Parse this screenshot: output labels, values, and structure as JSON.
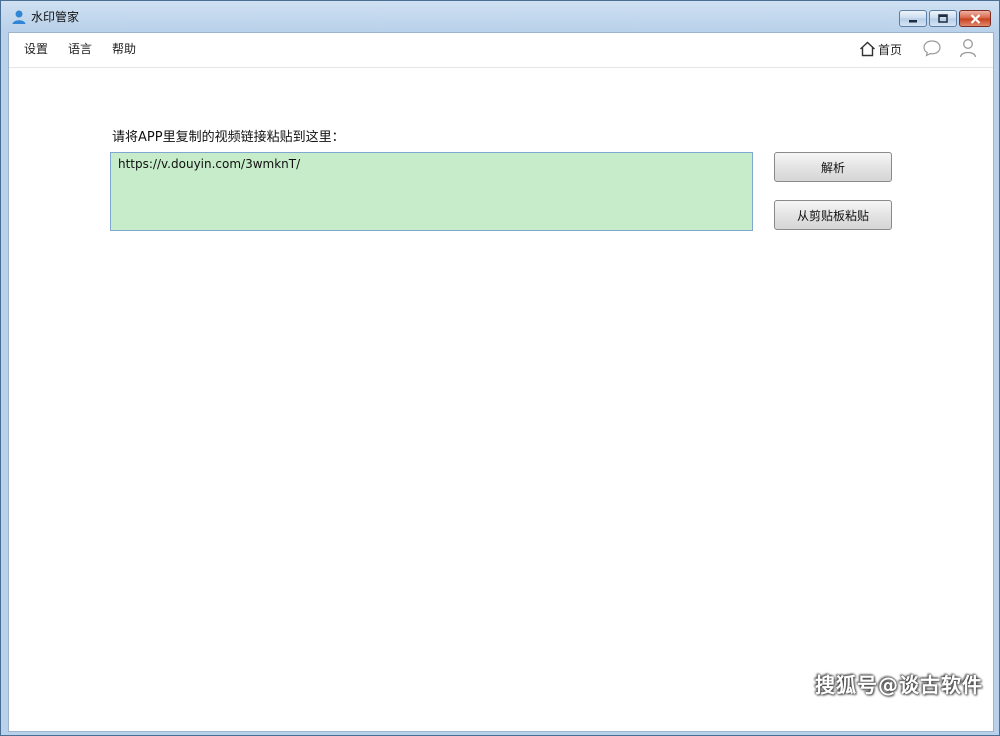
{
  "window": {
    "title": "水印管家",
    "icons": {
      "app": "user-figure-icon",
      "minimize": "minimize-icon",
      "maximize": "maximize-icon",
      "close": "close-icon"
    }
  },
  "menu": {
    "items": [
      {
        "label": "设置"
      },
      {
        "label": "语言"
      },
      {
        "label": "帮助"
      }
    ],
    "home_label": "首页",
    "icons": {
      "home": "home-icon",
      "chat": "chat-bubble-icon",
      "user": "user-icon"
    }
  },
  "main": {
    "prompt": "请将APP里复制的视频链接粘贴到这里：",
    "url_value": "https://v.douyin.com/3wmknT/",
    "parse_button": "解析",
    "paste_button": "从剪贴板粘贴",
    "input_background": "#c6ecca"
  },
  "overlay": {
    "watermark_text": "搜狐号@谈古软件"
  }
}
